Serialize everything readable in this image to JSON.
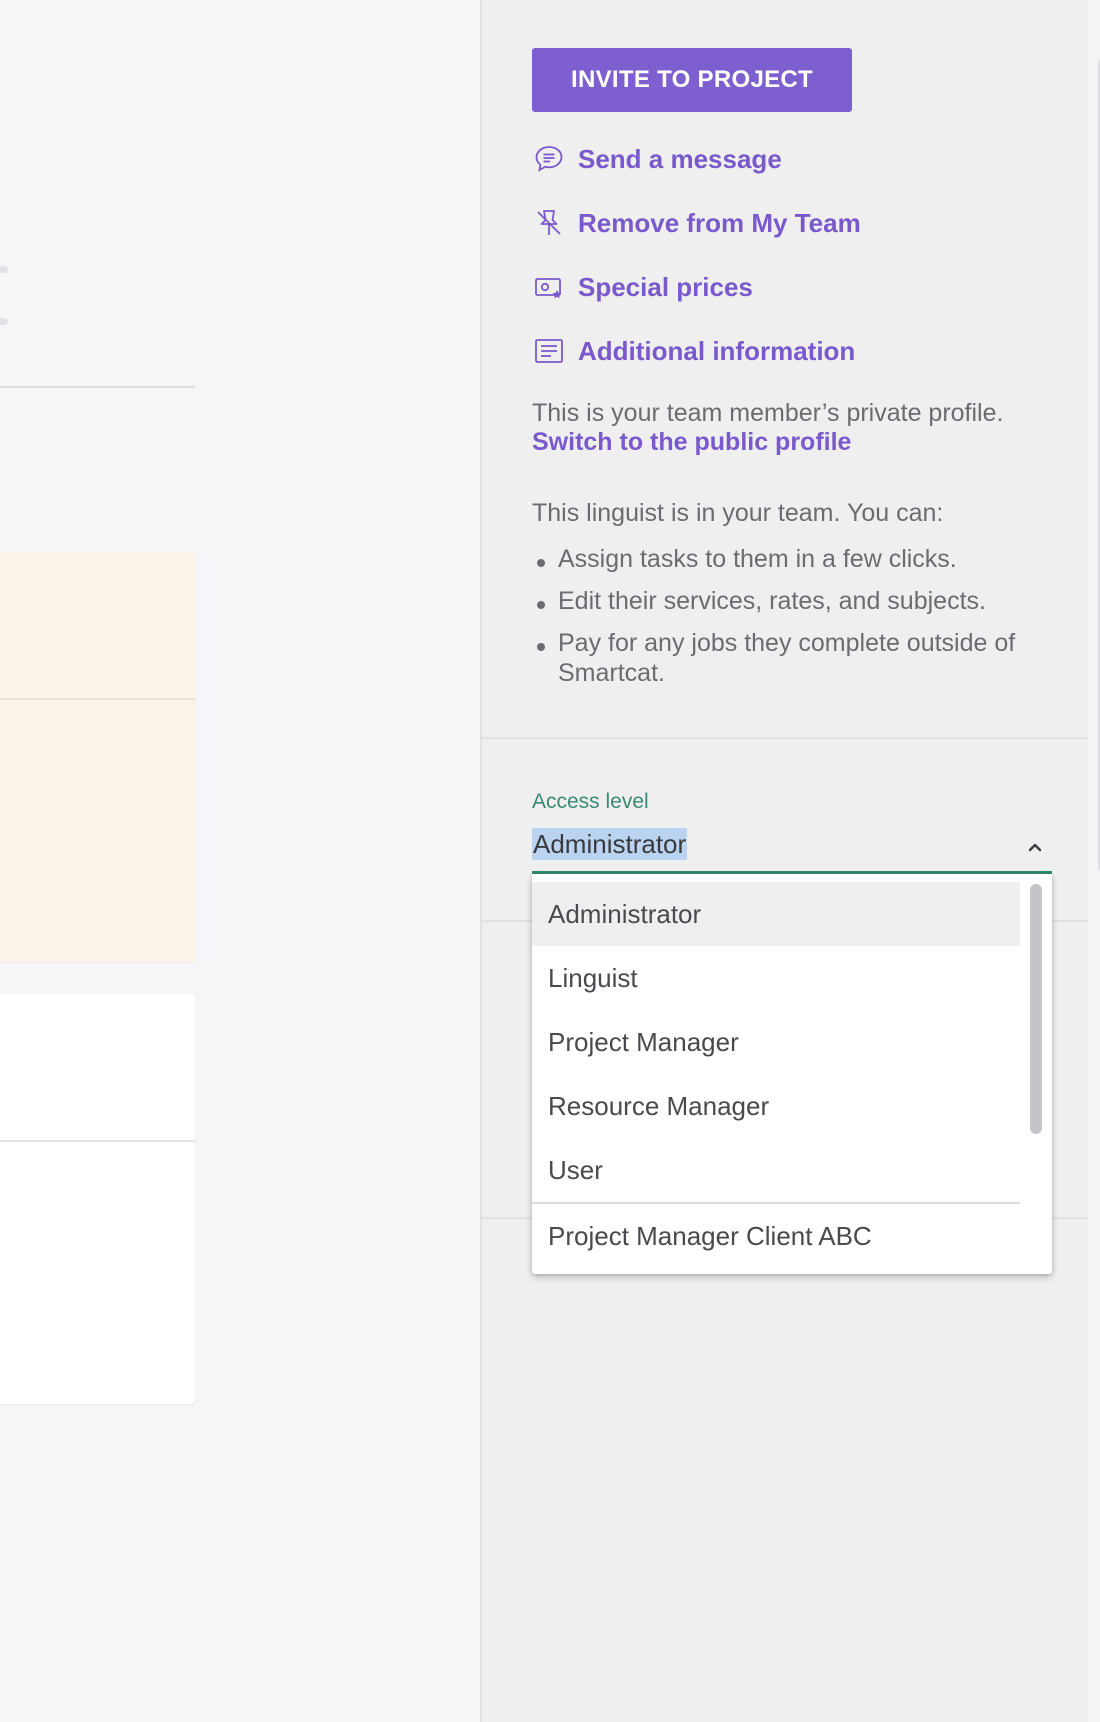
{
  "sidebar": {
    "invite_button": "INVITE TO PROJECT",
    "actions": [
      {
        "label": "Send a message",
        "icon": "chat-bubble-icon"
      },
      {
        "label": "Remove from My Team",
        "icon": "unpin-icon"
      },
      {
        "label": "Special prices",
        "icon": "price-tag-icon"
      },
      {
        "label": "Additional information",
        "icon": "notes-icon"
      }
    ],
    "profile_note": "This is your team member’s private profile.",
    "profile_link": "Switch to the public profile",
    "team_intro": "This linguist is in your team. You can:",
    "team_bullets": [
      "Assign tasks to them in a few clicks.",
      "Edit their services, rates, and subjects.",
      "Pay for any jobs they complete outside of Smartcat."
    ]
  },
  "access_level": {
    "label": "Access level",
    "selected": "Administrator",
    "options": [
      "Administrator",
      "Linguist",
      "Project Manager",
      "Resource Manager",
      "User",
      "Project Manager Client ABC"
    ]
  },
  "colors": {
    "accent": "#7d5fcf",
    "link": "#7a59cc",
    "field_active": "#2f8a6d",
    "text_muted": "#6c6c70",
    "panel_bg": "#efeff0"
  }
}
